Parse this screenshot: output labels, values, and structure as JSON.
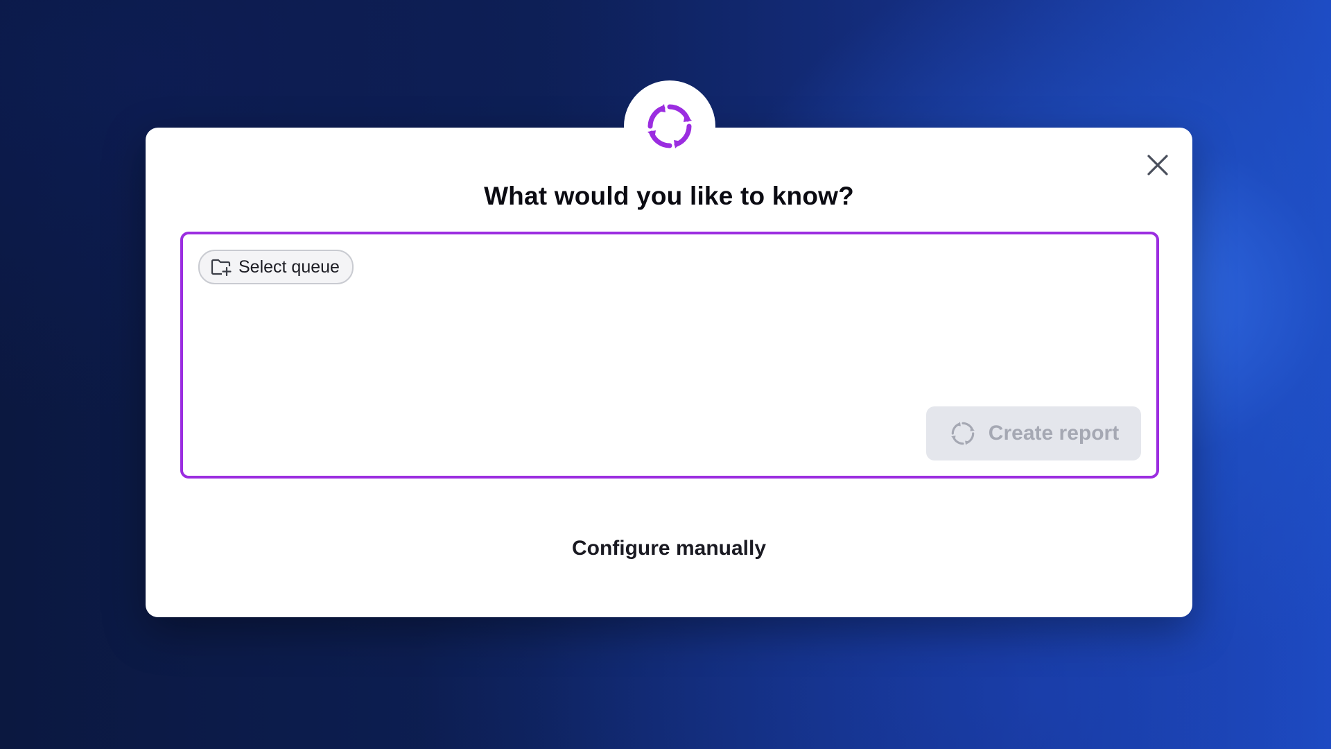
{
  "dialog": {
    "title": "What would you like to know?",
    "logo_icon": "swirl-logo-icon",
    "close_icon": "close-icon"
  },
  "prompt_box": {
    "select_queue": {
      "label": "Select queue",
      "icon": "folder-plus-icon"
    },
    "input": {
      "value": "",
      "placeholder": ""
    },
    "create_report": {
      "label": "Create report",
      "icon": "swirl-icon",
      "enabled": false
    }
  },
  "configure_manually": {
    "label": "Configure manually"
  },
  "colors": {
    "accent": "#9b2de0",
    "disabled_button_bg": "#e4e6ec",
    "disabled_button_text": "#a5a8b3"
  }
}
